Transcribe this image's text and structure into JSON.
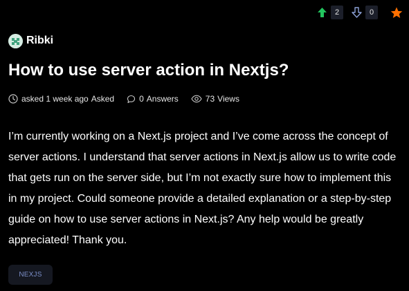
{
  "votes": {
    "upvotes": "2",
    "downvotes": "0",
    "up_color": "#22c55e",
    "down_color": "#8ea2d8",
    "star_color": "#ff7000",
    "up_icon": "arrow-up-icon",
    "down_icon": "arrow-down-icon",
    "star_icon": "star-icon"
  },
  "author": {
    "name": "Ribki",
    "avatar_icon": "avatar-icon"
  },
  "question": {
    "title": "How to use server action in Nextjs?",
    "asked_time": "asked 1 week ago",
    "asked_label": "Asked",
    "answers_count": "0",
    "answers_label": "Answers",
    "views_count": "73",
    "views_label": "Views",
    "clock_icon": "clock-icon",
    "chat_icon": "chat-bubble-icon",
    "eye_icon": "eye-icon",
    "body": "I’m currently working on a Next.js project and I’ve come across the concept of server actions. I understand that server actions in Next.js allow us to write code that gets run on the server side, but I’m not exactly sure how to implement this in my project. Could someone provide a detailed explanation or a step-by-step guide on how to use server actions in Next.js? Any help would be greatly appreciated! Thank you."
  },
  "tags": [
    {
      "label": "NEXJS"
    }
  ]
}
